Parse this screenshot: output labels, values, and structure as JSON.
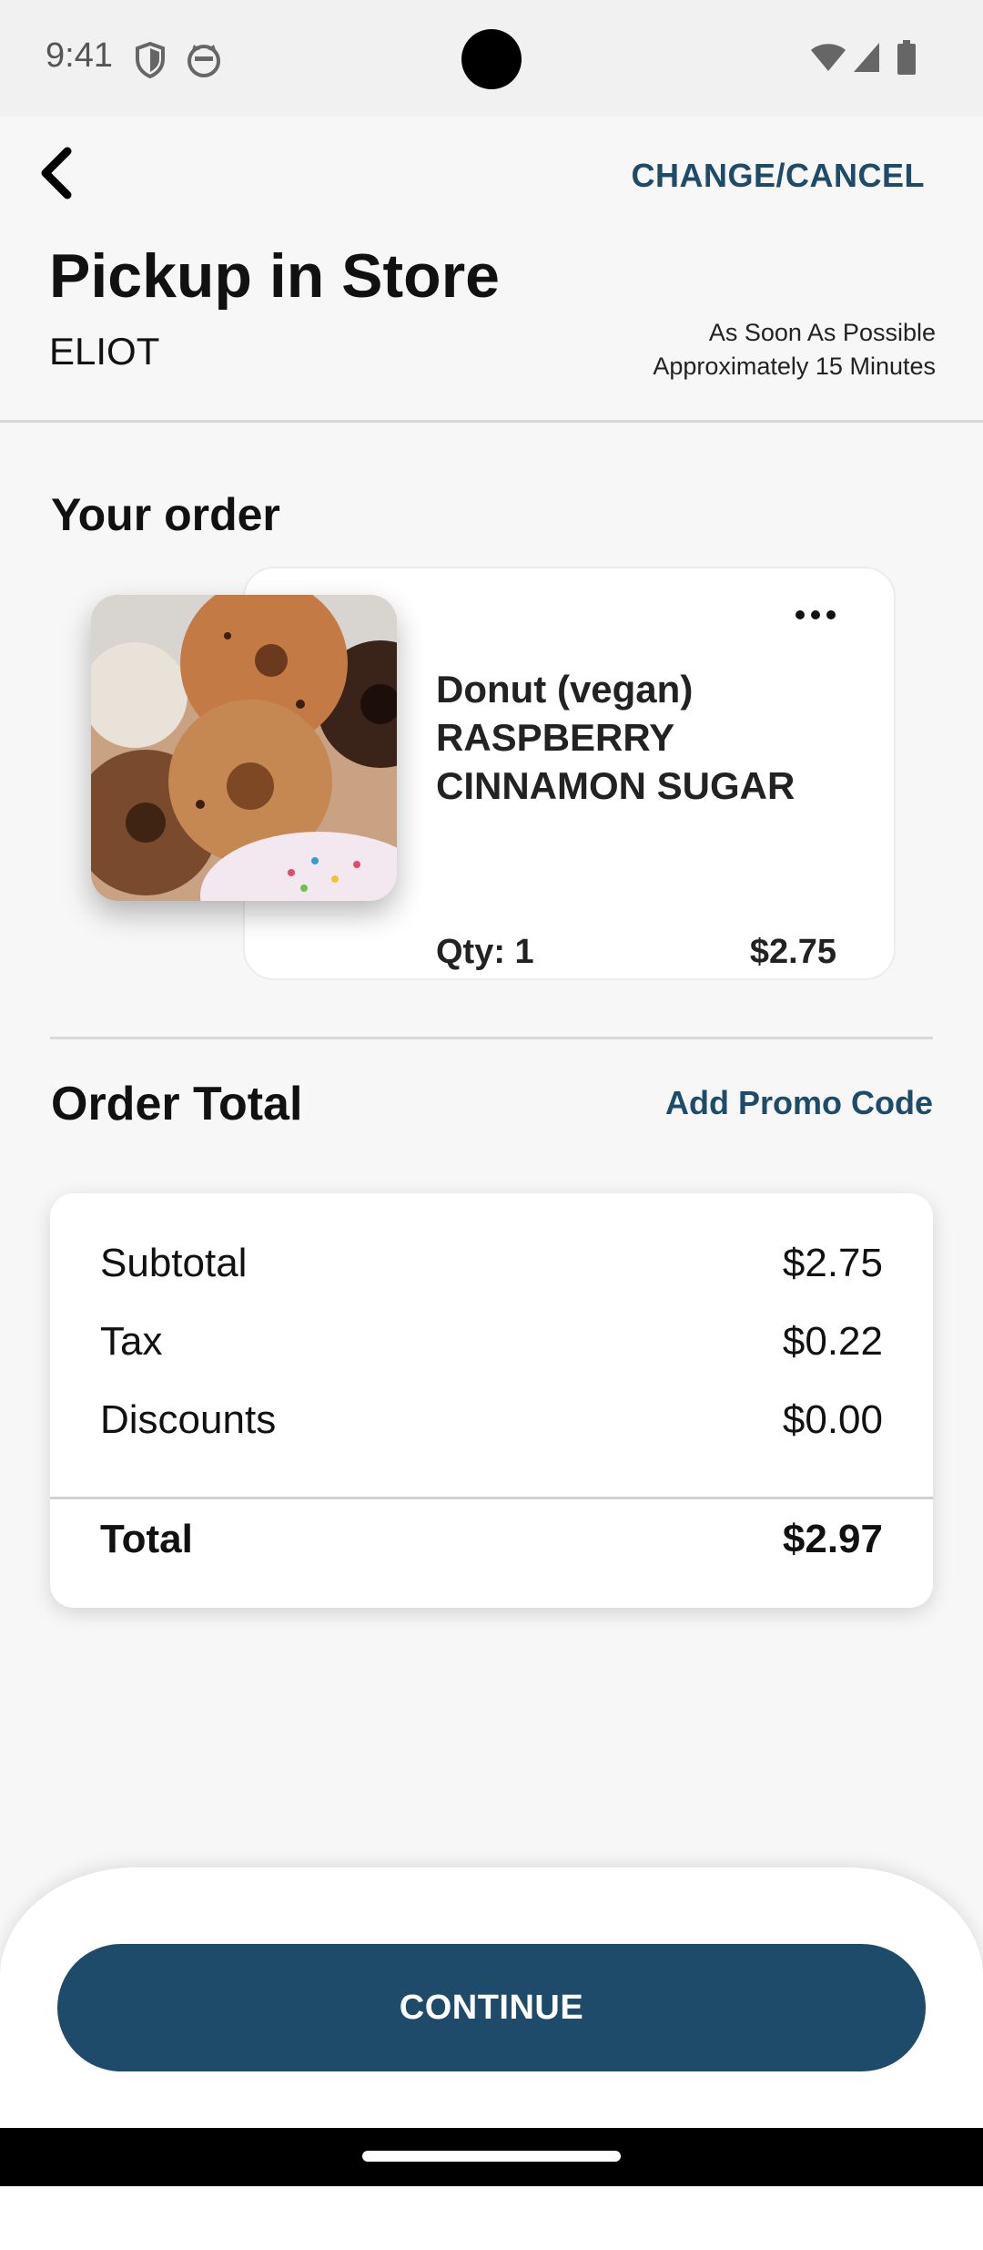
{
  "status_bar": {
    "time": "9:41"
  },
  "header": {
    "action_label": "CHANGE/CANCEL",
    "title": "Pickup in Store",
    "store": "ELIOT",
    "eta_primary": "As Soon As Possible",
    "eta_secondary": "Approximately 15 Minutes"
  },
  "order": {
    "section_title": "Your order",
    "items": [
      {
        "name": "Donut (vegan) RASPBERRY CINNAMON SUGAR",
        "qty_label": "Qty: 1",
        "price": "$2.75"
      }
    ]
  },
  "totals": {
    "section_title": "Order Total",
    "promo_label": "Add Promo Code",
    "subtotal_label": "Subtotal",
    "subtotal_value": "$2.75",
    "tax_label": "Tax",
    "tax_value": "$0.22",
    "discounts_label": "Discounts",
    "discounts_value": "$0.00",
    "total_label": "Total",
    "total_value": "$2.97"
  },
  "footer": {
    "continue_label": "CONTINUE"
  },
  "colors": {
    "accent": "#1e4b6a",
    "background": "#f7f7f7"
  },
  "icons": [
    "back-arrow-icon",
    "more-options-icon",
    "shield-icon",
    "cat-face-icon",
    "wifi-icon",
    "signal-icon",
    "battery-icon"
  ]
}
